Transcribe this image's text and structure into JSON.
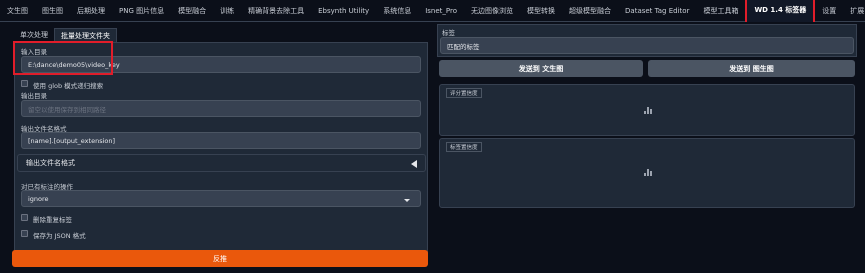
{
  "topnav": {
    "tabs": [
      {
        "label": "文生图",
        "name": "tab-txt2img"
      },
      {
        "label": "图生图",
        "name": "tab-img2img"
      },
      {
        "label": "后期处理",
        "name": "tab-extras"
      },
      {
        "label": "PNG 图片信息",
        "name": "tab-png-info"
      },
      {
        "label": "模型融合",
        "name": "tab-checkpoint-merger"
      },
      {
        "label": "训练",
        "name": "tab-train"
      },
      {
        "label": "精确背景去除工具",
        "name": "tab-rembg"
      },
      {
        "label": "Ebsynth Utility",
        "name": "tab-ebsynth-utility"
      },
      {
        "label": "系统信息",
        "name": "tab-system-info"
      },
      {
        "label": "Isnet_Pro",
        "name": "tab-isnet-pro"
      },
      {
        "label": "无边图像浏览",
        "name": "tab-image-browser"
      },
      {
        "label": "模型转换",
        "name": "tab-model-converter"
      },
      {
        "label": "超级模型融合",
        "name": "tab-supermerger"
      },
      {
        "label": "Dataset Tag Editor",
        "name": "tab-dataset-tag-editor"
      },
      {
        "label": "模型工具箱",
        "name": "tab-model-toolkit"
      },
      {
        "label": "WD 1.4 标签器",
        "name": "tab-wd14-tagger",
        "active": true
      },
      {
        "label": "设置",
        "name": "tab-settings"
      },
      {
        "label": "扩展",
        "name": "tab-extensions"
      }
    ]
  },
  "left": {
    "subtabs": {
      "single": "单次处理",
      "batch": "批量处理文件夹"
    },
    "input_dir": {
      "label": "输入目录",
      "value": "E:\\dance\\demo05\\video_key"
    },
    "glob": {
      "label": "使用 glob 模式递归搜索"
    },
    "output_dir": {
      "label": "输出目录",
      "placeholder": "留空以使用保存到相同路径"
    },
    "output_name": {
      "label": "输出文件名格式",
      "value": "[name].[output_extension]"
    },
    "accordion": {
      "label": "输出文件名格式"
    },
    "existing": {
      "label": "对已有标注的操作",
      "value": "ignore"
    },
    "dedupe": {
      "label": "删除重复标签"
    },
    "json": {
      "label": "保存为 JSON 格式"
    },
    "interrogate": {
      "label": "反推"
    }
  },
  "right": {
    "tags": {
      "label": "标签",
      "value": "匹配的标签"
    },
    "send_txt2img": "发送到 文生图",
    "send_img2img": "发送到 图生图",
    "rating": {
      "tag": "评分置信度"
    },
    "tag_conf": {
      "tag": "标签置信度"
    }
  },
  "colors": {
    "accent": "#ea580c",
    "highlight": "#e11d2a",
    "background": "#0b0f19",
    "panel": "#1f2937"
  }
}
